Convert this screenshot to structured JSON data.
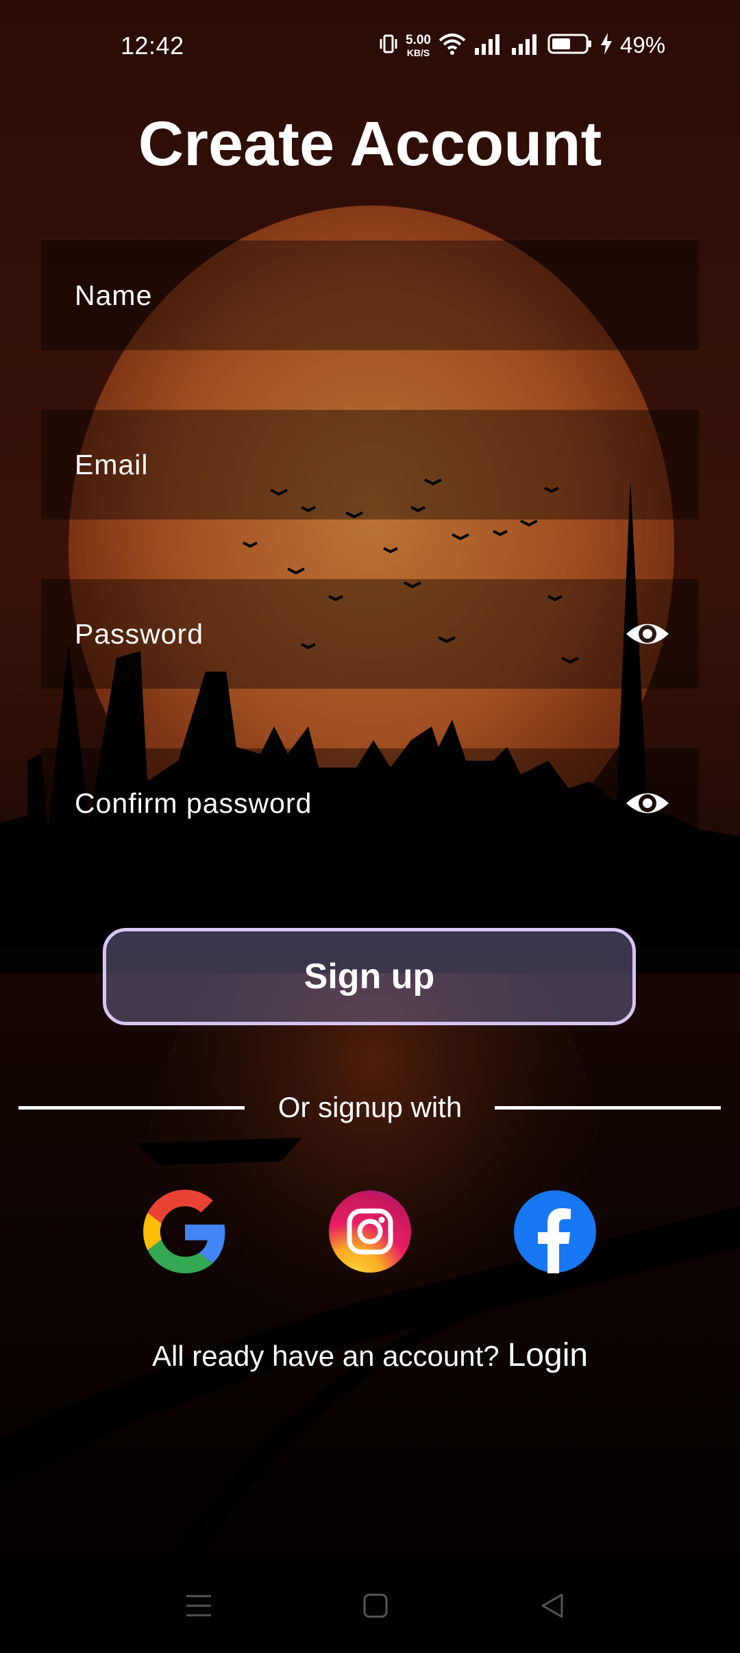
{
  "status_bar": {
    "time": "12:42",
    "net_speed_value": "5.00",
    "net_speed_unit": "KB/S",
    "battery_percent": "49%"
  },
  "title": "Create Account",
  "form": {
    "name_placeholder": "Name",
    "email_placeholder": "Email",
    "password_placeholder": "Password",
    "confirm_password_placeholder": "Confirm password"
  },
  "signup_button": "Sign up",
  "divider_text": "Or signup with",
  "social": [
    {
      "name": "Google",
      "icon": "google-icon"
    },
    {
      "name": "Instagram",
      "icon": "instagram-icon"
    },
    {
      "name": "Facebook",
      "icon": "facebook-icon"
    }
  ],
  "login_prompt": {
    "question": "All ready have an account?",
    "link": "Login"
  },
  "colors": {
    "button_border": "#d6c6f4",
    "button_fill": "#69628c",
    "sunset": "#c8642a",
    "sky": "#2a0c06"
  }
}
